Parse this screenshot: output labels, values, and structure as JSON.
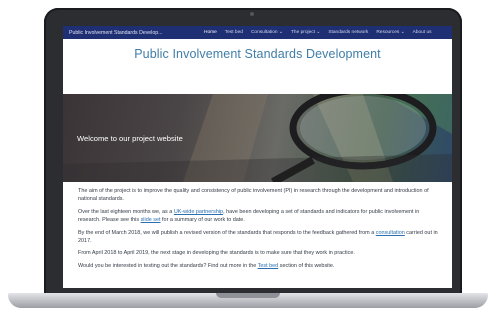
{
  "nav": {
    "brand": "Public Involvement Standards Develop...",
    "items": [
      {
        "label": "Home",
        "active": true
      },
      {
        "label": "Test bed",
        "active": false
      },
      {
        "label": "Consultation ⌄",
        "active": false
      },
      {
        "label": "The project ⌄",
        "active": false
      },
      {
        "label": "Standards network",
        "active": false
      },
      {
        "label": "Resources ⌄",
        "active": false
      },
      {
        "label": "About us",
        "active": false
      }
    ]
  },
  "site_title": "Public Involvement Standards Development",
  "hero": {
    "caption": "Welcome to our project website"
  },
  "content": {
    "p1": "The aim of the project is to improve the quality and consistency of public involvement (PI) in research through the development and introduction of national standards.",
    "p2_before": "Over the last eighteen months we, as a ",
    "p2_link1": "UK-wide partnership",
    "p2_mid": ", have been developing a set of standards and indicators for public involvement in research. Please see this ",
    "p2_link2": "slide set",
    "p2_after": " for a summary of our work to date.",
    "p3_before": "By the end of March 2018, we will publish a revised version of the standards that responds to the feedback gathered from a ",
    "p3_link": "consultation",
    "p3_after": " carried out in 2017.",
    "p4": "From April 2018 to April 2019, the next stage in developing the standards is to make sure that they work in practice.",
    "p5_before": "Would you be interested in testing out the standards? Find out more in the ",
    "p5_link": "Test bed",
    "p5_after": " section of this website."
  },
  "colors": {
    "nav_bg": "#1f2f73",
    "title": "#3f7ea8",
    "link": "#2a6fb0"
  }
}
